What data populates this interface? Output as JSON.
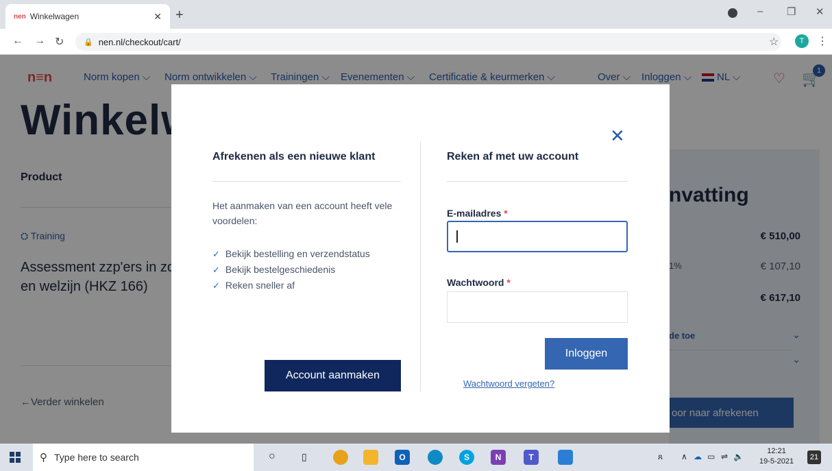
{
  "browser": {
    "tab_title": "Winkelwagen",
    "tab_favicon": "nen",
    "new_tab": "+",
    "url": "nen.nl/checkout/cart/",
    "profile_initial": "T"
  },
  "site": {
    "logo": "n≡n",
    "nav": {
      "norm_kopen": "Norm kopen ⌵",
      "norm_ontwikkelen": "Norm ontwikkelen ⌵",
      "trainingen": "Trainingen ⌵",
      "evenementen": "Evenementen ⌵",
      "certificatie": "Certificatie & keurmerken ⌵",
      "over": "Over ⌵",
      "inloggen": "Inloggen ⌵",
      "lang": "NL ⌵"
    },
    "cart_count": "1",
    "page_title": "Winkelw",
    "product_header": "Product",
    "training_tag": "Training",
    "product_name": "Assessment zzp'ers in zo en welzijn (HKZ 166)",
    "back_link": "←Verder winkelen",
    "summary": {
      "title": "nvatting",
      "subtotal": "€ 510,00",
      "vat_label": "1%",
      "vat": "€ 107,10",
      "total": "€ 617,10",
      "discount_label": "de toe",
      "checkout": "oor naar afrekenen"
    }
  },
  "modal": {
    "new_customer": {
      "title": "Afrekenen als een nieuwe klant",
      "intro": "Het aanmaken van een account heeft vele voordelen:",
      "benefits": [
        "Bekijk bestelling en verzendstatus",
        "Bekijk bestelgeschiedenis",
        "Reken sneller af"
      ],
      "create_button": "Account aanmaken"
    },
    "login": {
      "title": "Reken af met uw account",
      "email_label": "E-mailadres",
      "password_label": "Wachtwoord",
      "required_mark": "*",
      "login_button": "Inloggen",
      "forgot_link": "Wachtwoord vergeten?"
    },
    "close": "✕"
  },
  "taskbar": {
    "search_placeholder": "Type here to search",
    "time": "12:21",
    "date": "19-5-2021",
    "notifications": "21"
  },
  "colors": {
    "brand_red": "#e2474b",
    "brand_blue": "#3466b1",
    "navy": "#10275d"
  }
}
